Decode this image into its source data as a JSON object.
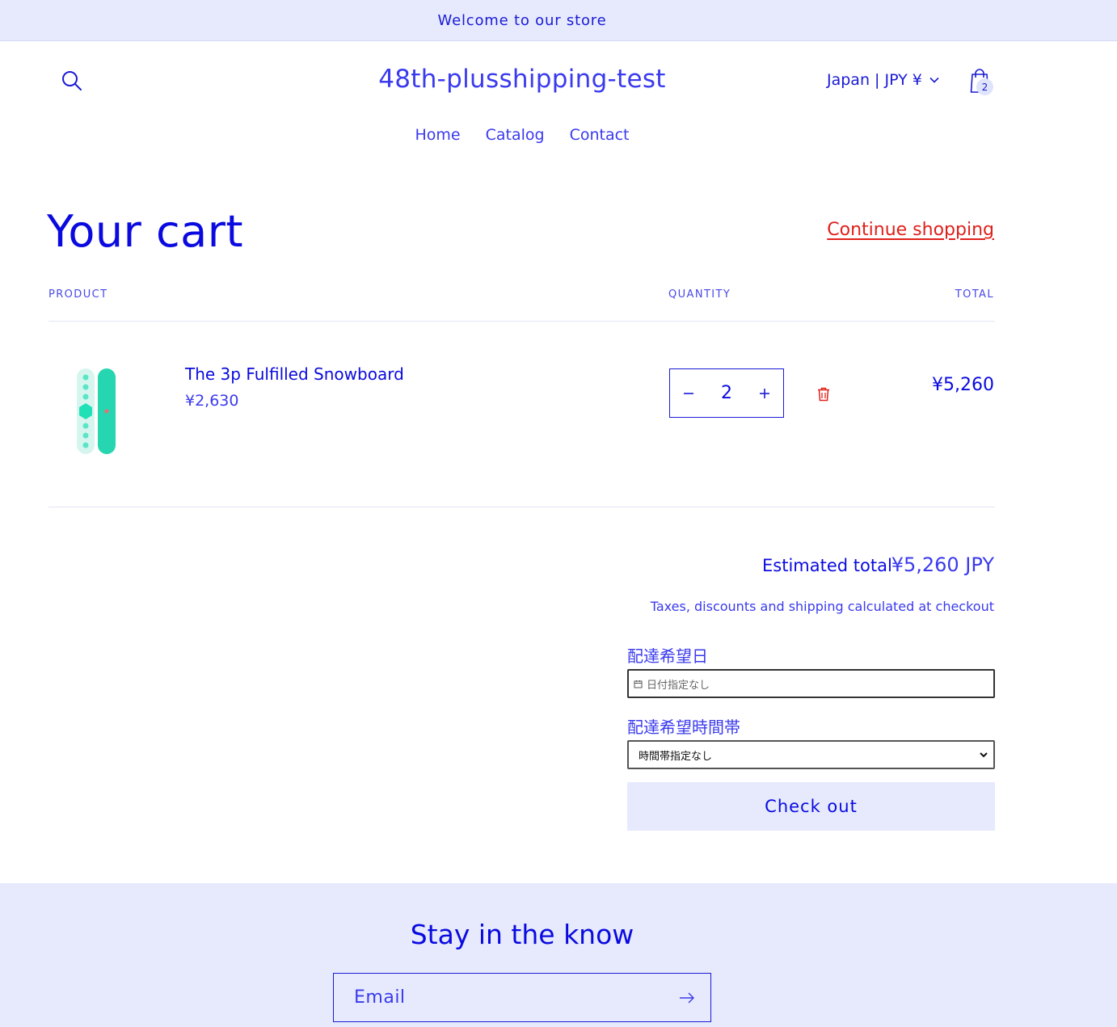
{
  "announcement": {
    "text": "Welcome to our store"
  },
  "header": {
    "store_name": "48th-plusshipping-test",
    "locale": "Japan | JPY ¥",
    "cart_count": "2",
    "nav": [
      "Home",
      "Catalog",
      "Contact"
    ]
  },
  "cart": {
    "title": "Your cart",
    "continue_label": "Continue shopping",
    "columns": {
      "product": "PRODUCT",
      "quantity": "QUANTITY",
      "total": "TOTAL"
    },
    "items": [
      {
        "name": "The 3p Fulfilled Snowboard",
        "price": "¥2,630",
        "quantity": "2",
        "line_total": "¥5,260"
      }
    ],
    "estimated_total_label": "Estimated total",
    "estimated_total_value": "¥5,260 JPY",
    "taxes_note": "Taxes, discounts and shipping calculated at checkout",
    "delivery_date_label": "配達希望日",
    "delivery_date_placeholder": "日付指定なし",
    "delivery_time_label": "配達希望時間帯",
    "delivery_time_selected": "時間帯指定なし",
    "checkout_label": "Check out"
  },
  "newsletter": {
    "title": "Stay in the know",
    "email_placeholder": "Email"
  },
  "colors": {
    "accent": "#0a0ae0",
    "link_red": "#e0201a",
    "band_bg": "#e6eafc"
  },
  "icons": [
    "search-icon",
    "chevron-down-icon",
    "cart-bag-icon",
    "minus-icon",
    "plus-icon",
    "trash-icon",
    "calendar-icon",
    "arrow-right-icon"
  ]
}
